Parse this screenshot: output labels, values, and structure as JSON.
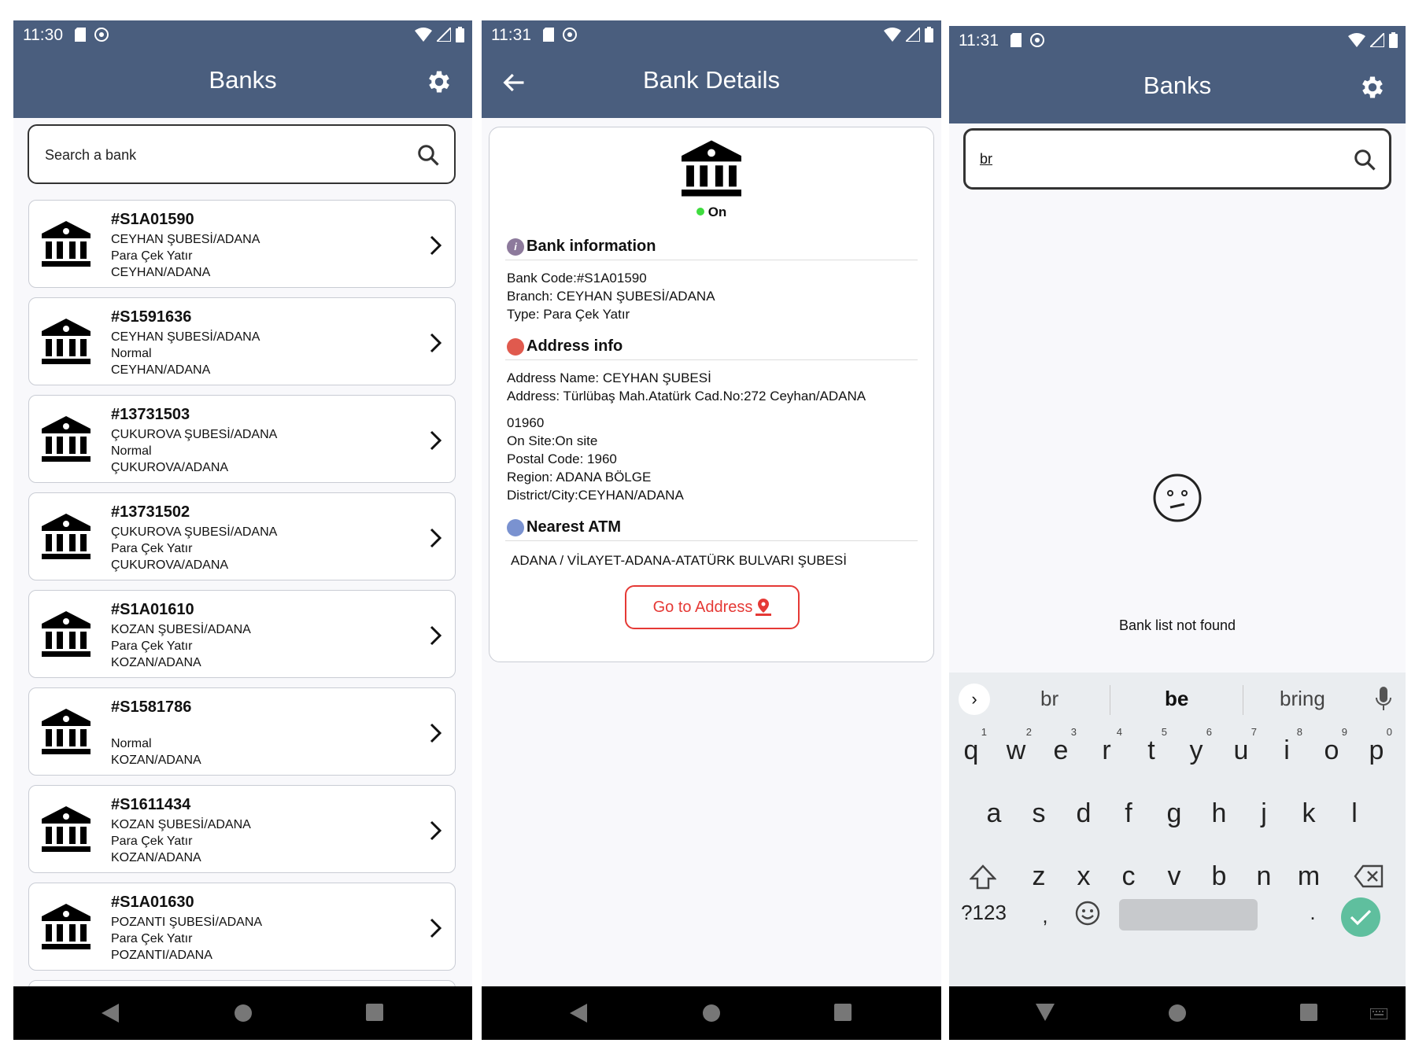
{
  "screen1": {
    "status": {
      "time": "11:30"
    },
    "title": "Banks",
    "search_placeholder": "Search a bank",
    "banks": [
      {
        "code": "#S1A01590",
        "branch": "CEYHAN ŞUBESİ/ADANA",
        "type": "Para Çek Yatır",
        "city": "CEYHAN/ADANA"
      },
      {
        "code": "#S1591636",
        "branch": "CEYHAN ŞUBESİ/ADANA",
        "type": "Normal",
        "city": "CEYHAN/ADANA"
      },
      {
        "code": "#13731503",
        "branch": "ÇUKUROVA ŞUBESİ/ADANA",
        "type": "Normal",
        "city": "ÇUKUROVA/ADANA"
      },
      {
        "code": "#13731502",
        "branch": "ÇUKUROVA ŞUBESİ/ADANA",
        "type": "Para Çek Yatır",
        "city": "ÇUKUROVA/ADANA"
      },
      {
        "code": "#S1A01610",
        "branch": "KOZAN ŞUBESİ/ADANA",
        "type": "Para Çek Yatır",
        "city": "KOZAN/ADANA"
      },
      {
        "code": "#S1581786",
        "branch": "",
        "type": "Normal",
        "city": "KOZAN/ADANA"
      },
      {
        "code": "#S1611434",
        "branch": "KOZAN ŞUBESİ/ADANA",
        "type": "Para Çek Yatır",
        "city": "KOZAN/ADANA"
      },
      {
        "code": "#S1A01630",
        "branch": "POZANTI ŞUBESİ/ADANA",
        "type": "Para Çek Yatır",
        "city": "POZANTI/ADANA"
      }
    ]
  },
  "screen2": {
    "status": {
      "time": "11:31"
    },
    "title": "Bank Details",
    "status_label": "On",
    "bank_info": {
      "heading": "Bank information",
      "code_line": "Bank Code:#S1A01590",
      "branch_line": "Branch: CEYHAN ŞUBESİ/ADANA",
      "type_line": "Type: Para Çek Yatır"
    },
    "address_info": {
      "heading": "Address info",
      "name_line": "Address Name: CEYHAN ŞUBESİ",
      "address_line": "Address: Türlübaş Mah.Atatürk Cad.No:272 Ceyhan/ADANA",
      "zip_line": "01960",
      "onsite_line": "On Site:On site",
      "postal_line": "Postal Code: 1960",
      "region_line": "Region: ADANA BÖLGE",
      "district_line": "District/City:CEYHAN/ADANA"
    },
    "atm": {
      "heading": "Nearest ATM",
      "value": "ADANA / VİLAYET-ADANA-ATATÜRK BULVARI ŞUBESİ"
    },
    "go_button": "Go to Address"
  },
  "screen3": {
    "status": {
      "time": "11:31"
    },
    "title": "Banks",
    "search_value": "br",
    "empty_text": "Bank list not found",
    "suggestions": [
      "br",
      "be",
      "bring"
    ],
    "row1": [
      [
        "q",
        "1"
      ],
      [
        "w",
        "2"
      ],
      [
        "e",
        "3"
      ],
      [
        "r",
        "4"
      ],
      [
        "t",
        "5"
      ],
      [
        "y",
        "6"
      ],
      [
        "u",
        "7"
      ],
      [
        "i",
        "8"
      ],
      [
        "o",
        "9"
      ],
      [
        "p",
        "0"
      ]
    ],
    "row2": [
      "a",
      "s",
      "d",
      "f",
      "g",
      "h",
      "j",
      "k",
      "l"
    ],
    "row3": [
      "z",
      "x",
      "c",
      "v",
      "b",
      "n",
      "m"
    ],
    "symbols_key": "?123",
    "comma_key": ",",
    "period_key": "."
  },
  "colors": {
    "appbar": "#4a5e7e",
    "accent_red": "#e53935",
    "status_green": "#3fdc3f",
    "enter_green": "#5fbf9e"
  }
}
